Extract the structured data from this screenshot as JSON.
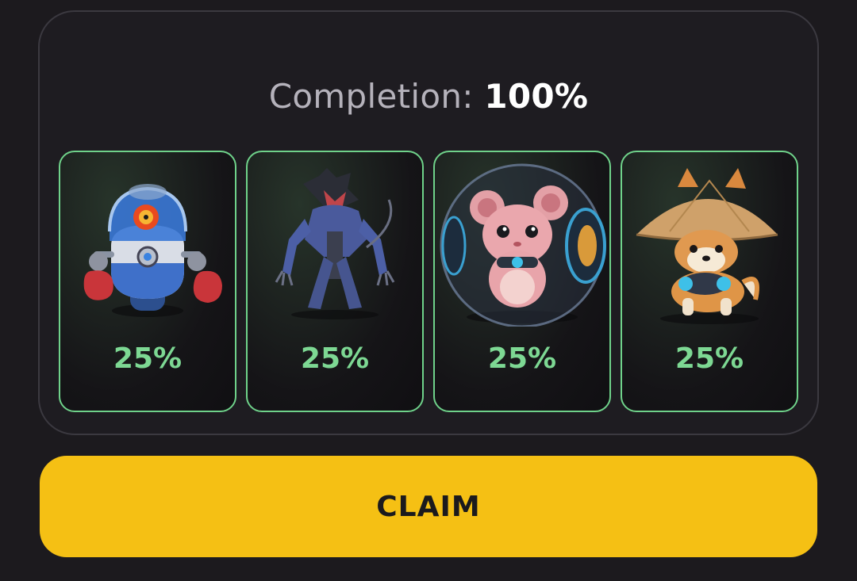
{
  "completion": {
    "label": "Completion:",
    "value": "100%"
  },
  "cards": [
    {
      "name": "boxing-robot",
      "percent": "25%"
    },
    {
      "name": "cyber-rat",
      "percent": "25%"
    },
    {
      "name": "hamster-in-ball",
      "percent": "25%"
    },
    {
      "name": "shiba-with-hat",
      "percent": "25%"
    }
  ],
  "claim": {
    "label": "CLAIM"
  },
  "colors": {
    "accent": "#f5c014",
    "success": "#7dd893",
    "card_border": "#6fd28a"
  }
}
